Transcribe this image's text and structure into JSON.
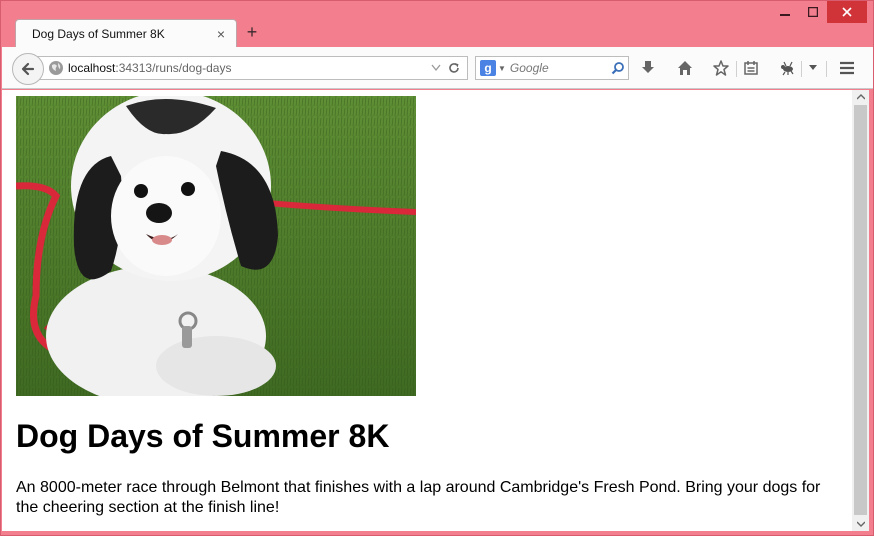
{
  "window": {
    "minimize_label": "–",
    "maximize_label": "□",
    "close_label": "✕"
  },
  "tab": {
    "title": "Dog Days of Summer 8K",
    "close_label": "×",
    "new_tab_label": "+"
  },
  "navbar": {
    "url_host": "localhost",
    "url_rest": ":34313/runs/dog-days",
    "search_placeholder": "Google",
    "search_engine_letter": "g"
  },
  "page": {
    "title": "Dog Days of Summer 8K",
    "description": "An 8000-meter race through Belmont that finishes with a lap around Cambridge's Fresh Pond. Bring your dogs for the cheering section at the finish line!"
  },
  "colors": {
    "window_frame": "#f27e8e",
    "close_button": "#d13438",
    "toolbar": "#fbfbfb"
  },
  "icons": [
    "back-arrow-icon",
    "globe-icon",
    "dropdown-arrow-icon",
    "reload-icon",
    "search-icon",
    "download-icon",
    "home-icon",
    "bookmark-star-icon",
    "reading-list-icon",
    "extension-icon",
    "menu-icon"
  ]
}
